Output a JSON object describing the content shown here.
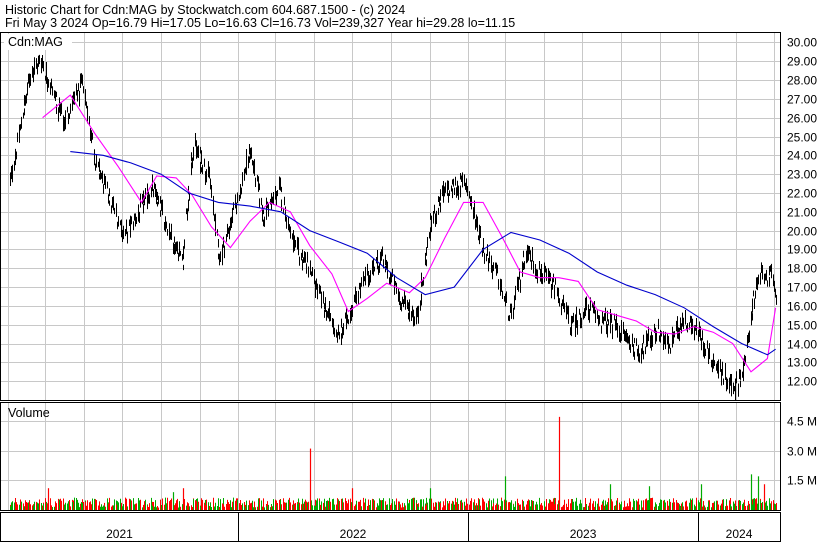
{
  "header": {
    "line1": "Historic Chart for Cdn:MAG by Stockwatch.com 604.687.1500 - (c) 2024",
    "line2": "Fri May  3 2024   Op=16.79   Hi=17.05   Lo=16.63   Cl=16.73   Vol=239,327   Year hi=29.28   lo=11.15"
  },
  "chart_data": {
    "type": "line",
    "price_panel": {
      "label": "Cdn:MAG",
      "y_ticks": [
        "30.00",
        "29.00",
        "28.00",
        "27.00",
        "26.00",
        "25.00",
        "24.00",
        "23.00",
        "22.00",
        "21.00",
        "20.00",
        "19.00",
        "18.00",
        "17.00",
        "16.00",
        "15.00",
        "14.00",
        "13.00",
        "12.00"
      ],
      "ylim": [
        11.0,
        30.5
      ],
      "grid": true,
      "series": [
        {
          "color": "#000000",
          "style": "daily high-low bars",
          "x": [
            "2021-01-04",
            "2021-02-05",
            "2021-02-22",
            "2021-03-30",
            "2021-04-30",
            "2021-05-20",
            "2021-06-15",
            "2021-07-05",
            "2021-07-25",
            "2021-08-17",
            "2021-09-20",
            "2021-10-05",
            "2021-10-22",
            "2021-11-16",
            "2021-12-03",
            "2021-12-29",
            "2022-01-20",
            "2022-02-10",
            "2022-03-08",
            "2022-04-01",
            "2022-04-20",
            "2022-05-13",
            "2022-06-10",
            "2022-07-05",
            "2022-08-01",
            "2022-08-17",
            "2022-09-15",
            "2022-10-12",
            "2022-11-02",
            "2022-11-23",
            "2022-12-28",
            "2023-01-25",
            "2023-02-15",
            "2023-03-10",
            "2023-04-03",
            "2023-04-20",
            "2023-05-19",
            "2023-06-14",
            "2023-07-11",
            "2023-07-31",
            "2023-08-25",
            "2023-09-28",
            "2023-10-27",
            "2023-11-17",
            "2023-12-07",
            "2024-01-01",
            "2024-01-22",
            "2024-02-12",
            "2024-02-29",
            "2024-03-14",
            "2024-03-28",
            "2024-04-12",
            "2024-04-25",
            "2024-05-03"
          ],
          "y": [
            22.5,
            28.3,
            29.1,
            25.8,
            27.8,
            23.6,
            21.3,
            19.8,
            20.8,
            22.3,
            19.5,
            18.5,
            24.6,
            22.8,
            18.5,
            21.5,
            24.2,
            20.8,
            22.2,
            19.0,
            18.3,
            16.3,
            14.3,
            16.4,
            18.0,
            18.5,
            16.4,
            15.3,
            20.3,
            22.0,
            22.6,
            19.0,
            17.7,
            15.3,
            19.0,
            18.0,
            16.9,
            14.9,
            15.9,
            15.2,
            14.9,
            13.5,
            14.7,
            13.8,
            15.4,
            14.6,
            13.2,
            12.2,
            11.7,
            12.7,
            16.3,
            17.8,
            17.5,
            16.73
          ],
          "high": [
            23.3,
            28.7,
            29.28,
            26.3,
            28.2,
            24.1,
            21.8,
            20.3,
            21.3,
            22.8,
            20.0,
            19.0,
            25.1,
            23.3,
            19.0,
            22.0,
            24.7,
            21.3,
            22.7,
            19.5,
            18.8,
            16.8,
            14.8,
            16.9,
            18.5,
            19.0,
            16.9,
            15.8,
            20.8,
            22.5,
            23.1,
            19.5,
            18.2,
            15.8,
            19.5,
            18.5,
            17.4,
            15.4,
            16.4,
            15.7,
            15.4,
            14.0,
            15.2,
            14.3,
            15.9,
            15.1,
            13.7,
            12.7,
            12.2,
            13.2,
            16.8,
            18.3,
            18.0,
            17.05
          ],
          "low": [
            21.8,
            27.6,
            28.4,
            25.1,
            27.1,
            22.9,
            20.6,
            19.1,
            20.1,
            21.6,
            18.8,
            17.8,
            23.9,
            22.1,
            17.8,
            20.8,
            23.5,
            20.1,
            21.5,
            18.3,
            17.6,
            15.6,
            13.6,
            15.7,
            17.3,
            17.8,
            15.7,
            14.6,
            19.6,
            21.3,
            21.9,
            18.3,
            17.0,
            14.6,
            18.3,
            17.3,
            16.2,
            14.2,
            15.2,
            14.5,
            14.2,
            12.8,
            14.0,
            13.1,
            14.7,
            13.9,
            12.5,
            11.5,
            11.15,
            12.0,
            15.6,
            17.1,
            16.8,
            16.63
          ]
        },
        {
          "color": "#ff00ff",
          "style": "short moving average",
          "x": [
            "2021-02-25",
            "2021-04-10",
            "2021-05-20",
            "2021-06-25",
            "2021-08-01",
            "2021-08-25",
            "2021-09-25",
            "2021-10-20",
            "2021-11-20",
            "2021-12-20",
            "2022-01-20",
            "2022-02-20",
            "2022-03-25",
            "2022-04-25",
            "2022-05-30",
            "2022-06-25",
            "2022-07-25",
            "2022-08-25",
            "2022-09-30",
            "2022-10-25",
            "2022-11-25",
            "2022-12-25",
            "2023-01-25",
            "2023-02-25",
            "2023-03-25",
            "2023-04-25",
            "2023-05-25",
            "2023-06-25",
            "2023-07-25",
            "2023-08-25",
            "2023-09-25",
            "2023-10-25",
            "2023-11-25",
            "2023-12-25",
            "2024-01-25",
            "2024-02-25",
            "2024-03-25",
            "2024-04-20",
            "2024-05-03"
          ],
          "y": [
            26.0,
            27.2,
            25.1,
            23.4,
            21.5,
            22.9,
            22.8,
            21.9,
            20.2,
            19.1,
            20.5,
            21.5,
            21.0,
            19.2,
            17.7,
            15.7,
            16.4,
            17.2,
            16.7,
            17.5,
            19.6,
            21.5,
            21.5,
            19.6,
            17.8,
            17.5,
            17.5,
            17.3,
            15.8,
            15.5,
            15.2,
            14.6,
            14.5,
            14.9,
            14.6,
            14.0,
            12.5,
            13.2,
            15.9
          ]
        },
        {
          "color": "#0000cc",
          "style": "long moving average",
          "x": [
            "2021-04-10",
            "2021-06-01",
            "2021-07-15",
            "2021-09-01",
            "2021-10-15",
            "2021-12-01",
            "2022-01-20",
            "2022-03-10",
            "2022-04-25",
            "2022-06-10",
            "2022-07-25",
            "2022-09-10",
            "2022-10-25",
            "2022-12-10",
            "2023-01-25",
            "2023-03-10",
            "2023-04-25",
            "2023-06-10",
            "2023-07-25",
            "2023-09-10",
            "2023-10-25",
            "2023-12-10",
            "2024-01-25",
            "2024-03-10",
            "2024-04-20",
            "2024-05-03"
          ],
          "y": [
            24.2,
            24.0,
            23.6,
            23.0,
            22.0,
            21.5,
            21.3,
            21.0,
            20.0,
            19.4,
            18.8,
            17.5,
            16.6,
            17.0,
            19.0,
            19.9,
            19.5,
            18.8,
            17.8,
            17.1,
            16.6,
            15.9,
            14.9,
            14.0,
            13.4,
            13.7
          ]
        }
      ]
    },
    "volume_panel": {
      "label": "Volume",
      "y_ticks": [
        "4.5 M",
        "3.0 M",
        "1.5 M"
      ],
      "ylim": [
        0,
        5.4
      ],
      "unit": "M",
      "bar_colors": {
        "up": "#00aa00",
        "down": "#ff0000"
      },
      "typical_volume": 0.5,
      "spikes": [
        {
          "x": "2021-03-05",
          "value": 1.1,
          "color": "#ff0000"
        },
        {
          "x": "2021-09-20",
          "value": 0.9,
          "color": "#00aa00"
        },
        {
          "x": "2021-10-05",
          "value": 1.1,
          "color": "#ff0000"
        },
        {
          "x": "2022-04-25",
          "value": 3.1,
          "color": "#ff0000"
        },
        {
          "x": "2022-07-01",
          "value": 1.1,
          "color": "#ff0000"
        },
        {
          "x": "2022-11-01",
          "value": 1.1,
          "color": "#00aa00"
        },
        {
          "x": "2023-03-01",
          "value": 1.7,
          "color": "#00aa00"
        },
        {
          "x": "2023-05-25",
          "value": 4.7,
          "color": "#ff0000"
        },
        {
          "x": "2023-08-15",
          "value": 1.3,
          "color": "#00aa00"
        },
        {
          "x": "2023-10-15",
          "value": 1.2,
          "color": "#00aa00"
        },
        {
          "x": "2024-01-05",
          "value": 1.3,
          "color": "#00aa00"
        },
        {
          "x": "2024-03-25",
          "value": 1.8,
          "color": "#00aa00"
        },
        {
          "x": "2024-04-05",
          "value": 1.7,
          "color": "#00aa00"
        },
        {
          "x": "2024-04-15",
          "value": 1.3,
          "color": "#ff0000"
        }
      ]
    },
    "x_ticks": [
      "2021",
      "2022",
      "2023",
      "2024"
    ]
  }
}
